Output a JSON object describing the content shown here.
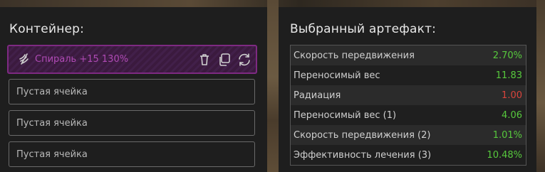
{
  "container": {
    "title": "Контейнер:",
    "active_slot": {
      "label": "Спираль +15 130%",
      "icons": [
        "artifact-spiral-icon",
        "trash-icon",
        "copy-icon",
        "refresh-icon"
      ]
    },
    "empty_slots": [
      "Пустая ячейка",
      "Пустая ячейка",
      "Пустая ячейка"
    ]
  },
  "artifact": {
    "title": "Выбранный артефакт:",
    "stats": [
      {
        "name": "Скорость передвижения",
        "value": "2.70%",
        "sign": "pos"
      },
      {
        "name": "Переносимый вес",
        "value": "11.83",
        "sign": "pos"
      },
      {
        "name": "Радиация",
        "value": "1.00",
        "sign": "neg"
      },
      {
        "name": "Переносимый вес (1)",
        "value": "4.06",
        "sign": "pos"
      },
      {
        "name": "Скорость передвижения (2)",
        "value": "1.01%",
        "sign": "pos"
      },
      {
        "name": "Эффективность лечения (3)",
        "value": "10.48%",
        "sign": "pos"
      }
    ]
  },
  "colors": {
    "panel_bg": "#1e1e1e",
    "active_border": "#7e2a82",
    "active_text": "#b04ab5",
    "positive": "#57c93d",
    "negative": "#d9443c"
  }
}
